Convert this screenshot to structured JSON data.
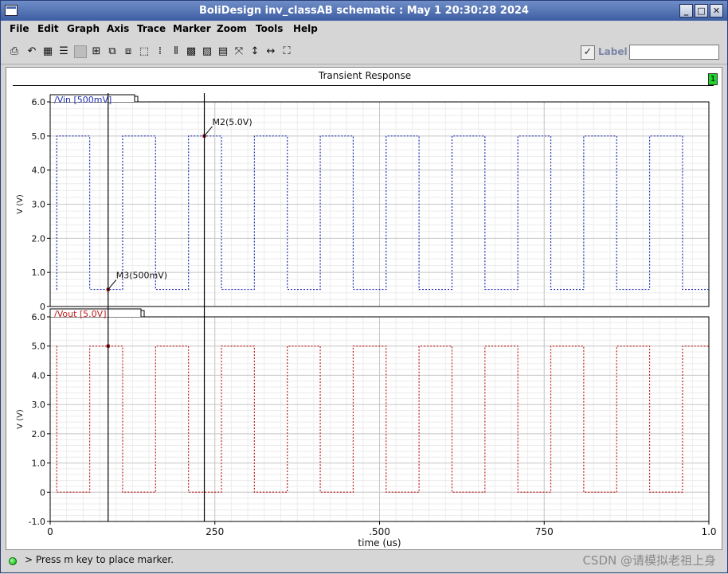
{
  "window": {
    "title": "BoliDesign inv_classAB schematic : May  1 20:30:28 2024",
    "buttons": [
      "_",
      "□",
      "✕"
    ]
  },
  "menu": [
    "File",
    "Edit",
    "Graph",
    "Axis",
    "Trace",
    "Marker",
    "Zoom",
    "Tools",
    "Help"
  ],
  "toolbar": {
    "icons": [
      "print-icon",
      "undo-icon",
      "grid-icon",
      "strips-icon",
      "disabled-icon",
      "zoom-box-icon",
      "copy-icon",
      "paste-icon",
      "fit-icon",
      "align-icon",
      "bars-icon",
      "hatch-icon",
      "hatch-alt-icon",
      "calc-icon",
      "fit-all-icon",
      "zoom-y-icon",
      "zoom-x-icon",
      "zoom-full-icon"
    ],
    "label_text": "Label",
    "label_checked": true,
    "label_value": ""
  },
  "plot": {
    "title": "Transient Response",
    "badge": "1",
    "xlabel": "time (us)",
    "xticks": [
      "0",
      "250",
      ".500",
      "750",
      "1.0"
    ],
    "xtick_values": [
      0,
      250,
      500,
      750,
      1000
    ]
  },
  "chart_data": [
    {
      "type": "line",
      "trace": "/Vin  [500mV]",
      "color": "#2030b0",
      "ylabel": "V (V)",
      "yticks": [
        "0",
        "1.0",
        "2.0",
        "3.0",
        "4.0",
        "5.0",
        "6.0"
      ],
      "ylim": [
        0,
        6
      ],
      "xlim": [
        0,
        1000
      ],
      "low": 0.5,
      "high": 5.0,
      "period": 100,
      "edges_x": [
        10,
        60,
        110,
        160,
        210,
        260,
        310,
        360,
        410,
        460,
        510,
        560,
        610,
        660,
        710,
        760,
        810,
        860,
        910,
        960
      ],
      "start_level": "low",
      "markers": [
        {
          "label": "M3(500mV)",
          "x": 88,
          "y": 0.5
        },
        {
          "label": "M2(5.0V)",
          "x": 234,
          "y": 5.0
        }
      ]
    },
    {
      "type": "line",
      "trace": "/Vout  [5.0V]",
      "color": "#c02020",
      "ylabel": "V (V)",
      "yticks": [
        "-1.0",
        "0",
        "1.0",
        "2.0",
        "3.0",
        "4.0",
        "5.0",
        "6.0"
      ],
      "ylim": [
        -1,
        6
      ],
      "xlim": [
        0,
        1000
      ],
      "low": 0.0,
      "high": 5.0,
      "period": 100,
      "edges_x": [
        10,
        60,
        110,
        160,
        210,
        260,
        310,
        360,
        410,
        460,
        510,
        560,
        610,
        660,
        710,
        760,
        810,
        860,
        910,
        960
      ],
      "start_level": "high",
      "markers": [
        {
          "label": "",
          "x": 88,
          "y": 5.0
        }
      ]
    }
  ],
  "cursors_x": [
    88,
    234
  ],
  "status": {
    "message": "> Press m key to place marker.",
    "watermark": "CSDN @请模拟老祖上身"
  }
}
